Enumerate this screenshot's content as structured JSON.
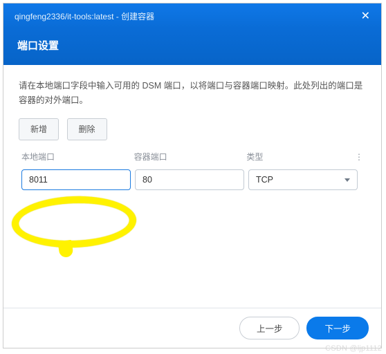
{
  "header": {
    "title": "qingfeng2336/it-tools:latest - 创建容器",
    "close_glyph": "✕"
  },
  "subheader": {
    "title": "端口设置"
  },
  "content": {
    "description": "请在本地端口字段中输入可用的 DSM 端口，以将端口与容器端口映射。此处列出的端口是容器的对外端口。",
    "add_label": "新增",
    "delete_label": "删除",
    "columns": {
      "local": "本地端口",
      "container": "容器端口",
      "type": "类型",
      "more_glyph": "⋮"
    },
    "rows": [
      {
        "local": "8011",
        "container": "80",
        "type": "TCP"
      }
    ]
  },
  "footer": {
    "prev_label": "上一步",
    "next_label": "下一步"
  },
  "watermark": "CSDN @ljp1112"
}
